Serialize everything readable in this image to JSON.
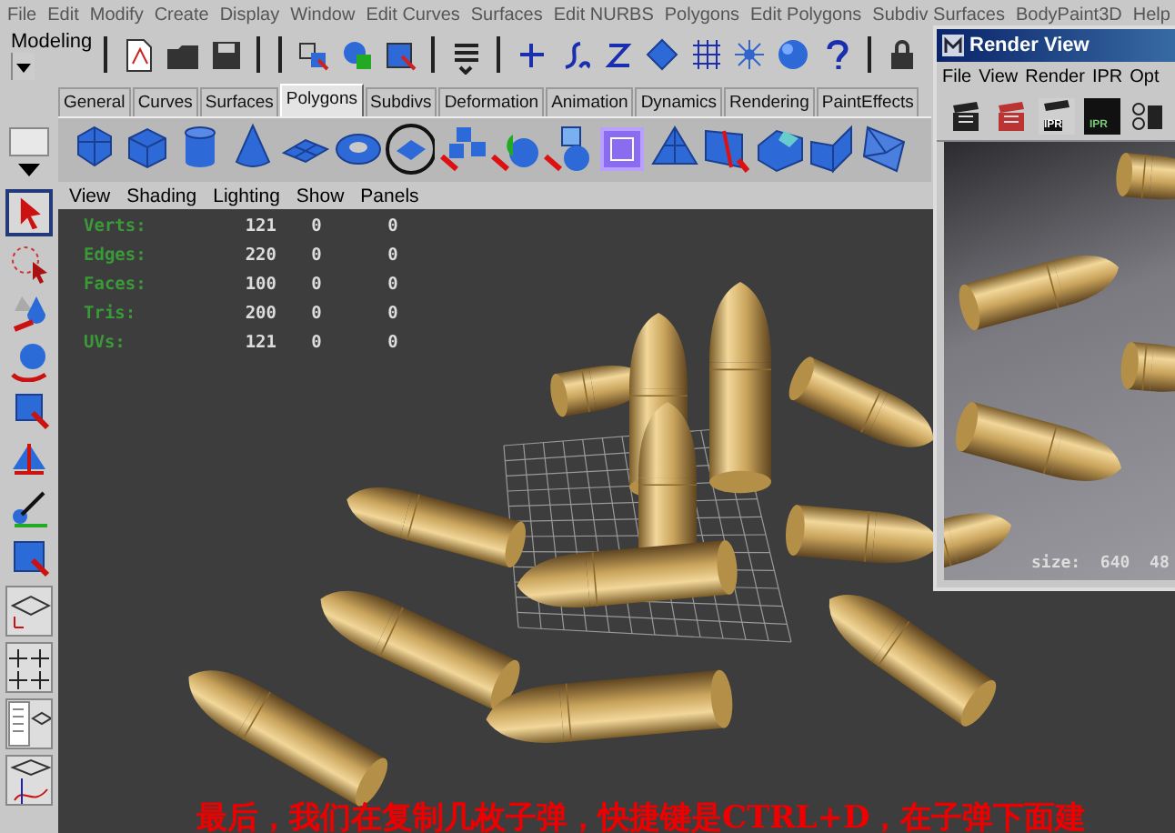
{
  "menu_bar": [
    "File",
    "Edit",
    "Modify",
    "Create",
    "Display",
    "Window",
    "Edit Curves",
    "Surfaces",
    "Edit NURBS",
    "Polygons",
    "Edit Polygons",
    "Subdiv Surfaces",
    "BodyPaint3D",
    "Help"
  ],
  "toolbar": {
    "mode": "Modeling"
  },
  "shelf_tabs": [
    {
      "label": "General",
      "selected": false
    },
    {
      "label": "Curves",
      "selected": false
    },
    {
      "label": "Surfaces",
      "selected": false
    },
    {
      "label": "Polygons",
      "selected": true
    },
    {
      "label": "Subdivs",
      "selected": false
    },
    {
      "label": "Deformation",
      "selected": false
    },
    {
      "label": "Animation",
      "selected": false
    },
    {
      "label": "Dynamics",
      "selected": false
    },
    {
      "label": "Rendering",
      "selected": false
    },
    {
      "label": "PaintEffects",
      "selected": false
    }
  ],
  "panel_menu": [
    "View",
    "Shading",
    "Lighting",
    "Show",
    "Panels"
  ],
  "hud": [
    {
      "label": "Verts:",
      "values": [
        "121",
        "0",
        "0"
      ]
    },
    {
      "label": "Edges:",
      "values": [
        "220",
        "0",
        "0"
      ]
    },
    {
      "label": "Faces:",
      "values": [
        "100",
        "0",
        "0"
      ]
    },
    {
      "label": "Tris:",
      "values": [
        "200",
        "0",
        "0"
      ]
    },
    {
      "label": "UVs:",
      "values": [
        "121",
        "0",
        "0"
      ]
    }
  ],
  "render_view": {
    "title": "Render View",
    "menu": [
      "File",
      "View",
      "Render",
      "IPR",
      "Opt"
    ],
    "icon_badges": [
      "IPR",
      "IPR"
    ],
    "size_label": "size:  640  48"
  },
  "caption": "最后，我们在复制几枚子弹，快捷键是CTRL+D，在子弹下面建"
}
